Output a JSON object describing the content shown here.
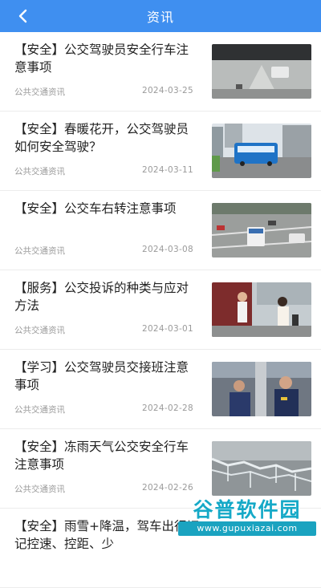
{
  "header": {
    "title": "资讯",
    "back_icon": "chevron-left-icon"
  },
  "articles": [
    {
      "title": "【安全】公交驾驶员安全行车注意事项",
      "source": "公共交通资讯",
      "date": "2024-03-25"
    },
    {
      "title": "【安全】春暖花开，公交驾驶员如何安全驾驶？",
      "source": "公共交通资讯",
      "date": "2024-03-11"
    },
    {
      "title": "【安全】公交车右转注意事项",
      "source": "公共交通资讯",
      "date": "2024-03-08"
    },
    {
      "title": "【服务】公交投诉的种类与应对方法",
      "source": "公共交通资讯",
      "date": "2024-03-01"
    },
    {
      "title": "【学习】公交驾驶员交接班注意事项",
      "source": "公共交通资讯",
      "date": "2024-02-28"
    },
    {
      "title": "【安全】冻雨天气公交安全行车注意事项",
      "source": "公共交通资讯",
      "date": "2024-02-26"
    },
    {
      "title": "【安全】雨雪+降温，驾车出行切记控速、控距、少",
      "source": "",
      "date": ""
    }
  ],
  "watermark": {
    "title": "谷普软件园",
    "url": "www.gupuxiazai.com"
  },
  "colors": {
    "header": "#3f8ff0",
    "text": "#222222",
    "meta": "#9a9a9a"
  }
}
